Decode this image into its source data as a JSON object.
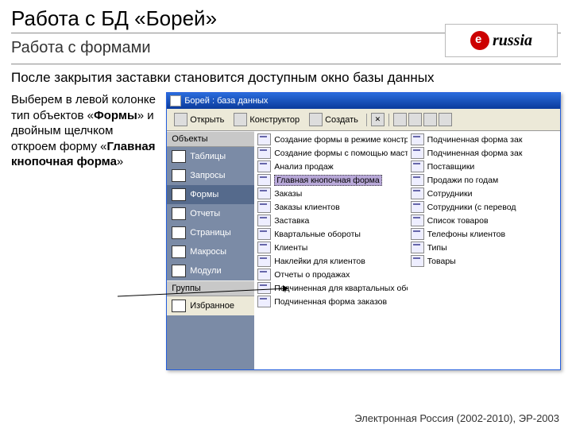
{
  "slide_title": "Работа с БД «Борей»",
  "slide_subtitle": "Работа с формами",
  "intro": "После закрытия заставки становится доступным окно базы данных",
  "left_para_1": "Выберем в левой колонке тип объектов «",
  "left_bold_1": "Формы",
  "left_para_2": "» и двойным щелчком откроем форму «",
  "left_bold_2": "Главная кнопочная форма",
  "left_para_3": "»",
  "logo_text": "russia",
  "footer": "Электронная Россия (2002-2010), ЭР-2003",
  "window": {
    "title": "Борей : база данных",
    "toolbar": {
      "open": "Открыть",
      "design": "Конструктор",
      "create": "Создать"
    },
    "sidebar": {
      "group1": "Объекты",
      "items": [
        "Таблицы",
        "Запросы",
        "Формы",
        "Отчеты",
        "Страницы",
        "Макросы",
        "Модули"
      ],
      "group2": "Группы",
      "fav": "Избранное"
    },
    "col1": [
      "Создание формы в режиме конструктора",
      "Создание формы с помощью мастера",
      "Анализ продаж",
      "Главная кнопочная форма",
      "Заказы",
      "Заказы клиентов",
      "Заставка",
      "Квартальные обороты",
      "Клиенты",
      "Наклейки для клиентов",
      "Отчеты о продажах",
      "Подчиненная для квартальных оборотов",
      "Подчиненная форма заказов"
    ],
    "col2": [
      "Подчиненная форма зак",
      "Подчиненная форма зак",
      "Поставщики",
      "Продажи по годам",
      "Сотрудники",
      "Сотрудники (с перевод",
      "Список товаров",
      "Телефоны клиентов",
      "Типы",
      "Товары"
    ]
  }
}
